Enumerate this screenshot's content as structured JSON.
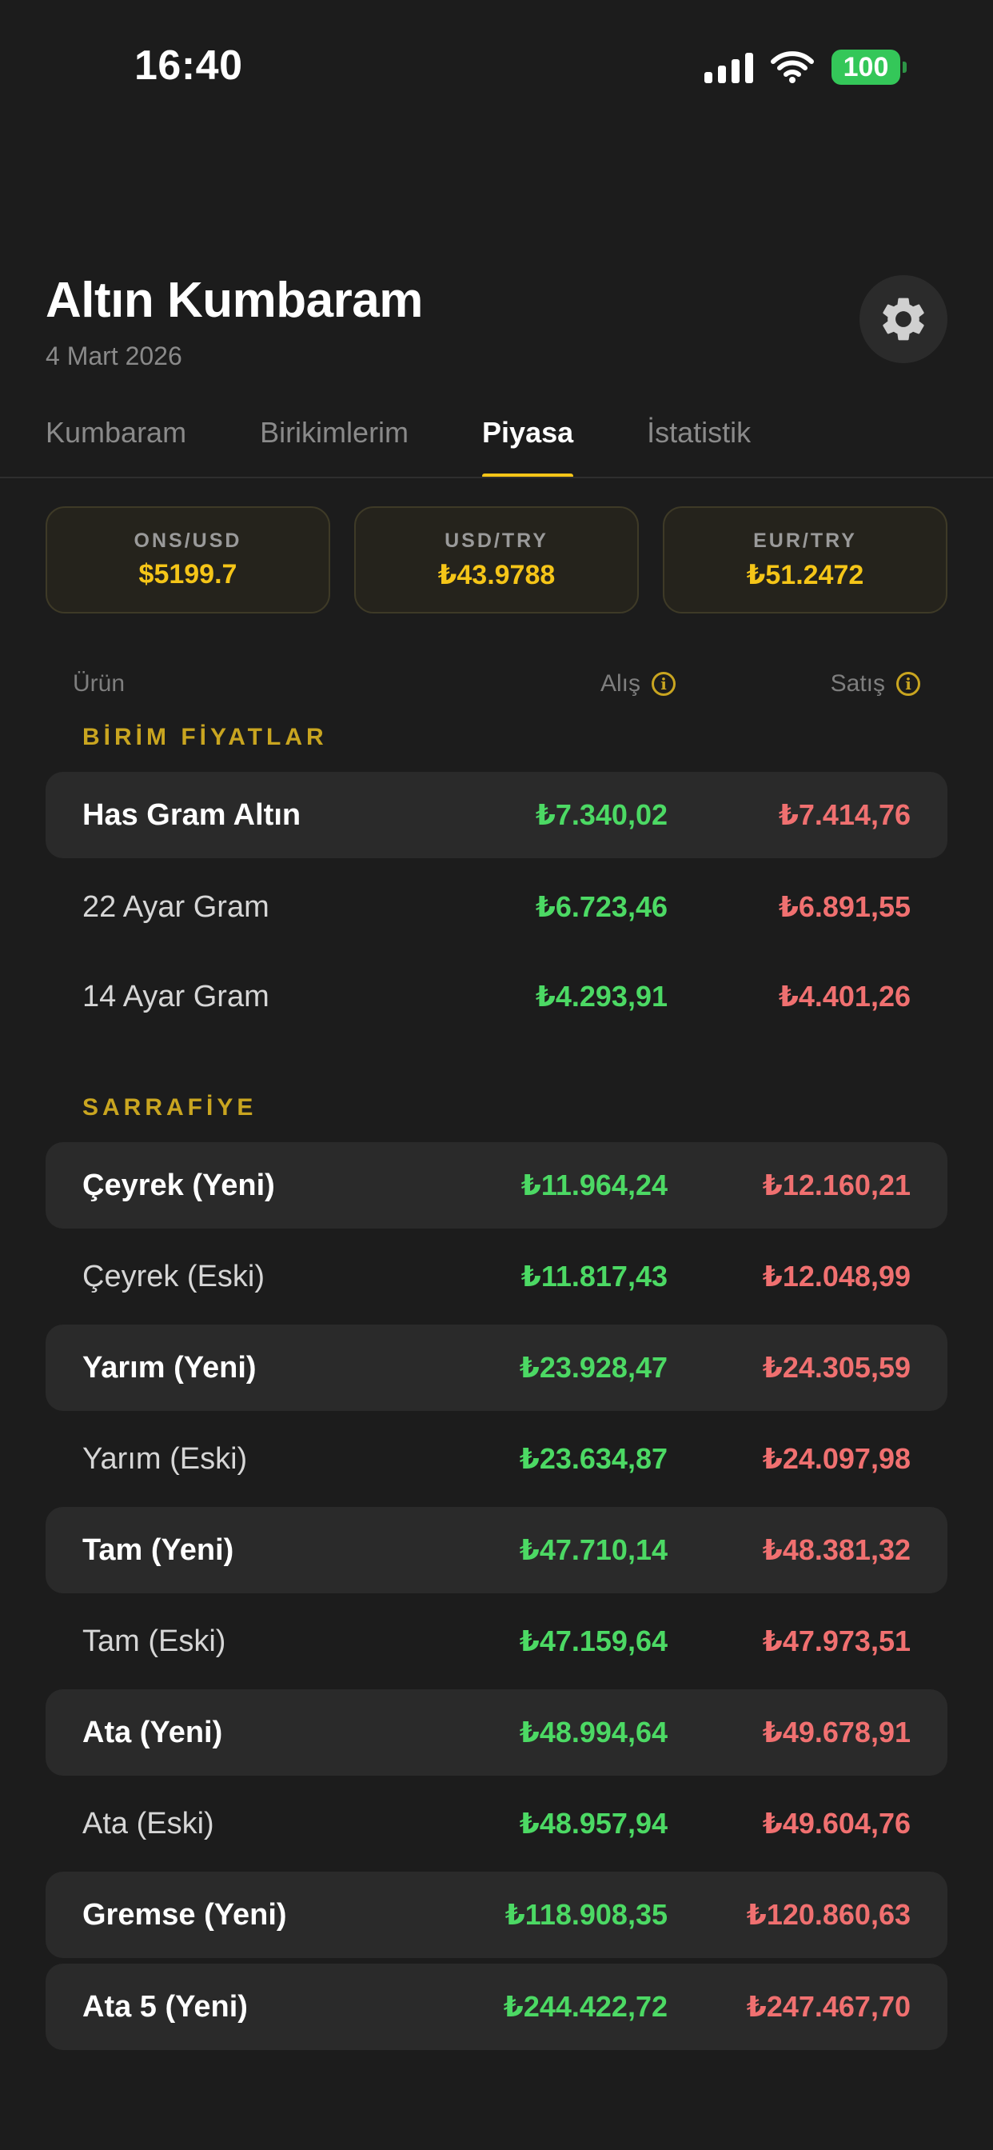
{
  "status": {
    "time": "16:40",
    "battery": "100"
  },
  "header": {
    "title": "Altın Kumbaram",
    "date": "4 Mart 2026"
  },
  "tabs": [
    {
      "label": "Kumbaram"
    },
    {
      "label": "Birikimlerim"
    },
    {
      "label": "Piyasa",
      "active": true
    },
    {
      "label": "İstatistik"
    }
  ],
  "rates": [
    {
      "label": "ONS/USD",
      "value": "$5199.7"
    },
    {
      "label": "USD/TRY",
      "value": "₺43.9788"
    },
    {
      "label": "EUR/TRY",
      "value": "₺51.2472"
    }
  ],
  "columns": {
    "product": "Ürün",
    "buy": "Alış",
    "sell": "Satış"
  },
  "sections": {
    "unit_prices": {
      "title": "BİRİM FİYATLAR",
      "rows": [
        {
          "name": "Has Gram Altın",
          "buy": "₺7.340,02",
          "sell": "₺7.414,76"
        },
        {
          "name": "22 Ayar Gram",
          "buy": "₺6.723,46",
          "sell": "₺6.891,55"
        },
        {
          "name": "14 Ayar Gram",
          "buy": "₺4.293,91",
          "sell": "₺4.401,26"
        }
      ]
    },
    "coins": {
      "title": "SARRAFİYE",
      "rows": [
        {
          "name": "Çeyrek (Yeni)",
          "buy": "₺11.964,24",
          "sell": "₺12.160,21"
        },
        {
          "name": "Çeyrek (Eski)",
          "buy": "₺11.817,43",
          "sell": "₺12.048,99"
        },
        {
          "name": "Yarım (Yeni)",
          "buy": "₺23.928,47",
          "sell": "₺24.305,59"
        },
        {
          "name": "Yarım (Eski)",
          "buy": "₺23.634,87",
          "sell": "₺24.097,98"
        },
        {
          "name": "Tam (Yeni)",
          "buy": "₺47.710,14",
          "sell": "₺48.381,32"
        },
        {
          "name": "Tam (Eski)",
          "buy": "₺47.159,64",
          "sell": "₺47.973,51"
        },
        {
          "name": "Ata (Yeni)",
          "buy": "₺48.994,64",
          "sell": "₺49.678,91"
        },
        {
          "name": "Ata (Eski)",
          "buy": "₺48.957,94",
          "sell": "₺49.604,76"
        },
        {
          "name": "Gremse (Yeni)",
          "buy": "₺118.908,35",
          "sell": "₺120.860,63"
        },
        {
          "name": "Ata 5 (Yeni)",
          "buy": "₺244.422,72",
          "sell": "₺247.467,70"
        }
      ]
    }
  },
  "colors": {
    "accent": "#f5c518",
    "buy": "#4cd964",
    "sell": "#f07070",
    "background": "#1c1c1c"
  }
}
